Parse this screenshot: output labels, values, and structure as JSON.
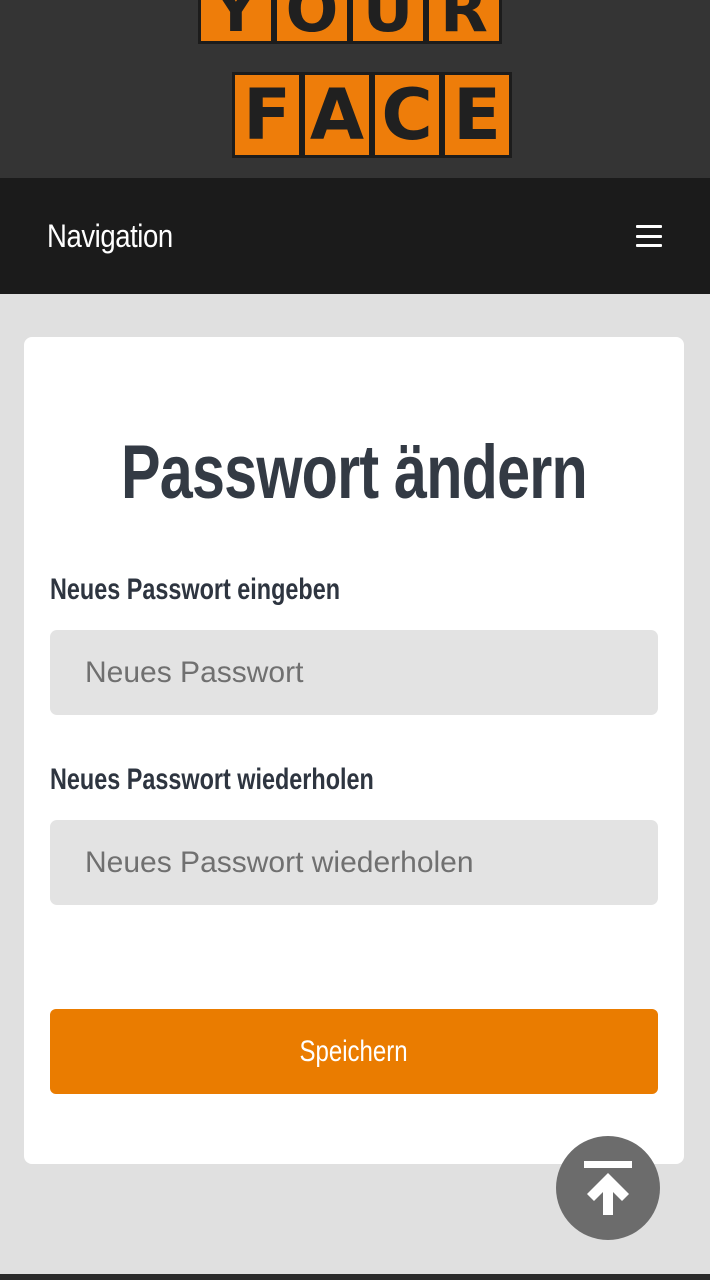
{
  "logo": {
    "top_letters": [
      "Y",
      "O",
      "U",
      "R"
    ],
    "bottom_letters": [
      "F",
      "A",
      "C",
      "E"
    ]
  },
  "nav": {
    "title": "Navigation",
    "menu_icon": "hamburger-menu-icon"
  },
  "form": {
    "heading": "Passwort ändern",
    "new_password_label": "Neues Passwort eingeben",
    "new_password_placeholder": "Neues Passwort",
    "new_password_value": "",
    "repeat_password_label": "Neues Passwort wiederholen",
    "repeat_password_placeholder": "Neues Passwort wiederholen",
    "repeat_password_value": "",
    "save_label": "Speichern"
  },
  "scroll_top": {
    "icon": "arrow-up-to-line-icon"
  },
  "colors": {
    "accent": "#ea7c00",
    "nav_bg": "#1b1b1b",
    "header_bg": "#343434",
    "page_bg": "#e0e0e0",
    "heading_text": "#333a44"
  }
}
